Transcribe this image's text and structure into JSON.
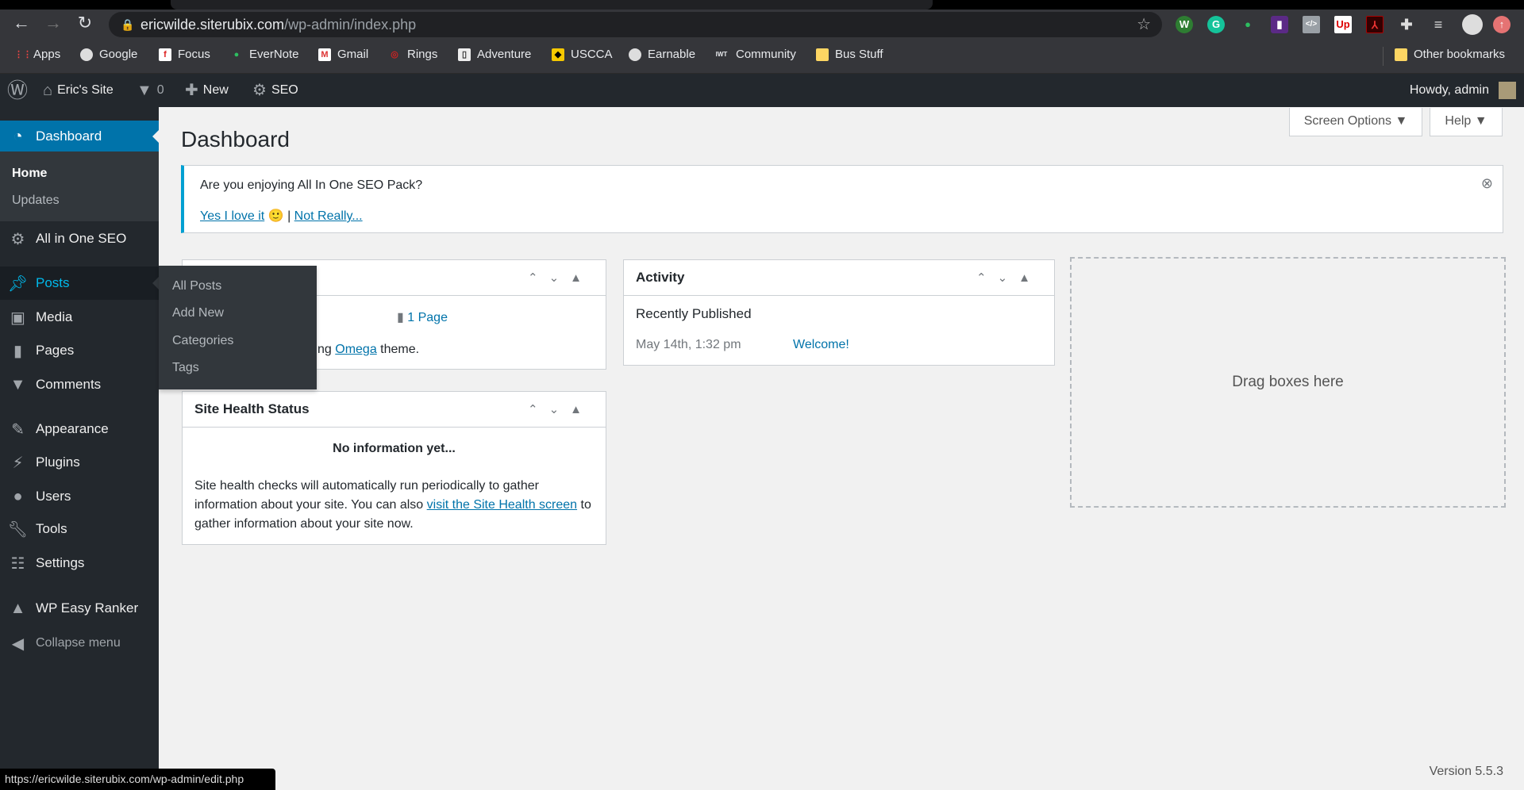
{
  "browser": {
    "url_host": "ericwilde.siterubix.com",
    "url_path": "/wp-admin/index.php",
    "bookmarks": [
      "Apps",
      "Google",
      "Focus",
      "EverNote",
      "Gmail",
      "Rings",
      "Adventure",
      "USCCA",
      "Earnable",
      "Community",
      "Bus Stuff"
    ],
    "other_bookmarks": "Other bookmarks",
    "status_url": "https://ericwilde.siterubix.com/wp-admin/edit.php"
  },
  "adminbar": {
    "site": "Eric's Site",
    "comments": "0",
    "new": "New",
    "seo": "SEO",
    "howdy": "Howdy, admin"
  },
  "sidebar": {
    "dashboard": "Dashboard",
    "home": "Home",
    "updates": "Updates",
    "items": [
      "All in One SEO",
      "Posts",
      "Media",
      "Pages",
      "Comments",
      "Appearance",
      "Plugins",
      "Users",
      "Tools",
      "Settings",
      "WP Easy Ranker",
      "Collapse menu"
    ],
    "flyout": [
      "All Posts",
      "Add New",
      "Categories",
      "Tags"
    ]
  },
  "main": {
    "title": "Dashboard",
    "screen_options": "Screen Options",
    "help": "Help",
    "notice": {
      "text": "Are you enjoying All In One SEO Pack?",
      "yes": "Yes I love it",
      "emoji": "🙂",
      "sep": "|",
      "no": "Not Really..."
    },
    "glance": {
      "pages": "1 Page",
      "theme_pre": "ng ",
      "theme": "Omega",
      "theme_post": " theme."
    },
    "health": {
      "title": "Site Health Status",
      "none": "No information yet...",
      "text1": "Site health checks will automatically run periodically to gather information about your site. You can also ",
      "link": "visit the Site Health screen",
      "text2": " to gather information about your site now."
    },
    "activity": {
      "title": "Activity",
      "recent": "Recently Published",
      "date": "May 14th, 1:32 pm",
      "post": "Welcome!"
    },
    "drag": "Drag boxes here",
    "version": "Version 5.5.3"
  }
}
